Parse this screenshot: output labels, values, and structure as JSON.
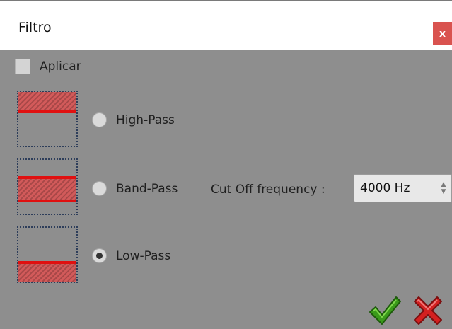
{
  "window": {
    "title": "Filtro",
    "close_label": "x"
  },
  "apply": {
    "label": "Aplicar",
    "checked": false
  },
  "filters": [
    {
      "label": "High-Pass",
      "selected": false
    },
    {
      "label": "Band-Pass",
      "selected": false
    },
    {
      "label": "Low-Pass",
      "selected": true
    }
  ],
  "cutoff": {
    "label": "Cut Off frequency :",
    "value": "4000 Hz"
  },
  "icons": {
    "ok": "check-icon",
    "cancel": "cross-icon",
    "close": "close-icon"
  },
  "colors": {
    "background": "#8e8e8e",
    "filter_line": "#e01010",
    "close": "#d9534f",
    "ok": "#3a9a1a",
    "cancel": "#d32020"
  }
}
